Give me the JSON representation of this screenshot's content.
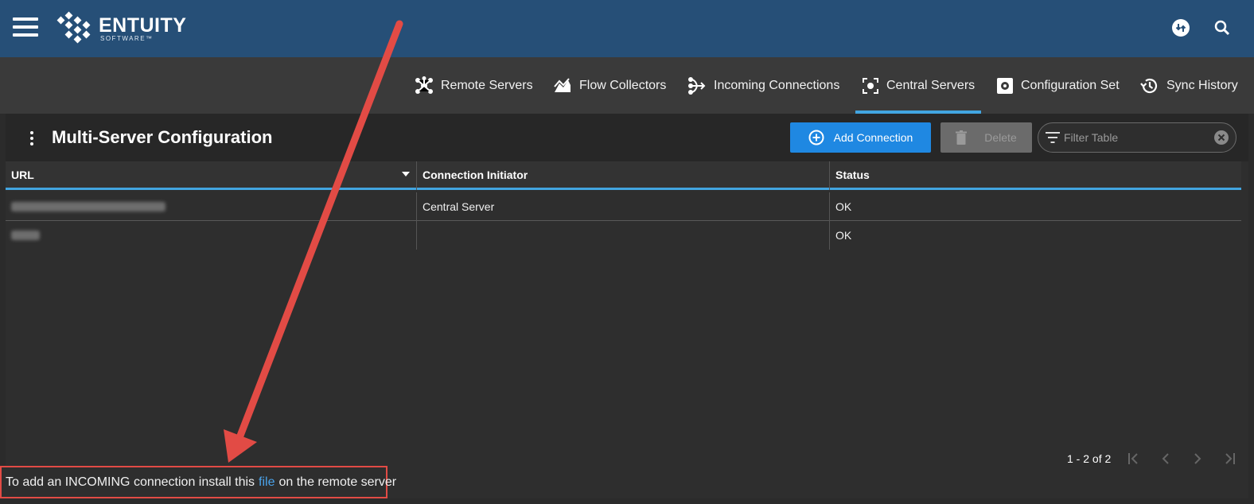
{
  "header": {
    "logo_name": "ENTUITY",
    "logo_sub": "SOFTWARE™"
  },
  "tabs": [
    {
      "label": "Remote Servers",
      "icon": "hub-icon"
    },
    {
      "label": "Flow Collectors",
      "icon": "flow-icon"
    },
    {
      "label": "Incoming Connections",
      "icon": "incoming-icon"
    },
    {
      "label": "Central Servers",
      "icon": "central-icon",
      "active": true
    },
    {
      "label": "Configuration Set",
      "icon": "config-icon"
    },
    {
      "label": "Sync History",
      "icon": "history-icon"
    }
  ],
  "page": {
    "title": "Multi-Server Configuration",
    "add_label": "Add Connection",
    "delete_label": "Delete",
    "filter_placeholder": "Filter Table"
  },
  "table": {
    "columns": [
      "URL",
      "Connection Initiator",
      "Status"
    ],
    "rows": [
      {
        "url": "",
        "initiator": "Central Server",
        "status": "OK"
      },
      {
        "url": "",
        "initiator": "",
        "status": "OK"
      }
    ]
  },
  "pager": {
    "text": "1 - 2 of 2"
  },
  "footer": {
    "before": "To add an INCOMING connection install this",
    "link": "file",
    "after": "on the remote server"
  },
  "colors": {
    "header": "#264f77",
    "accent": "#42a5e0",
    "button": "#1f88e2",
    "annotation": "#e24b45"
  }
}
